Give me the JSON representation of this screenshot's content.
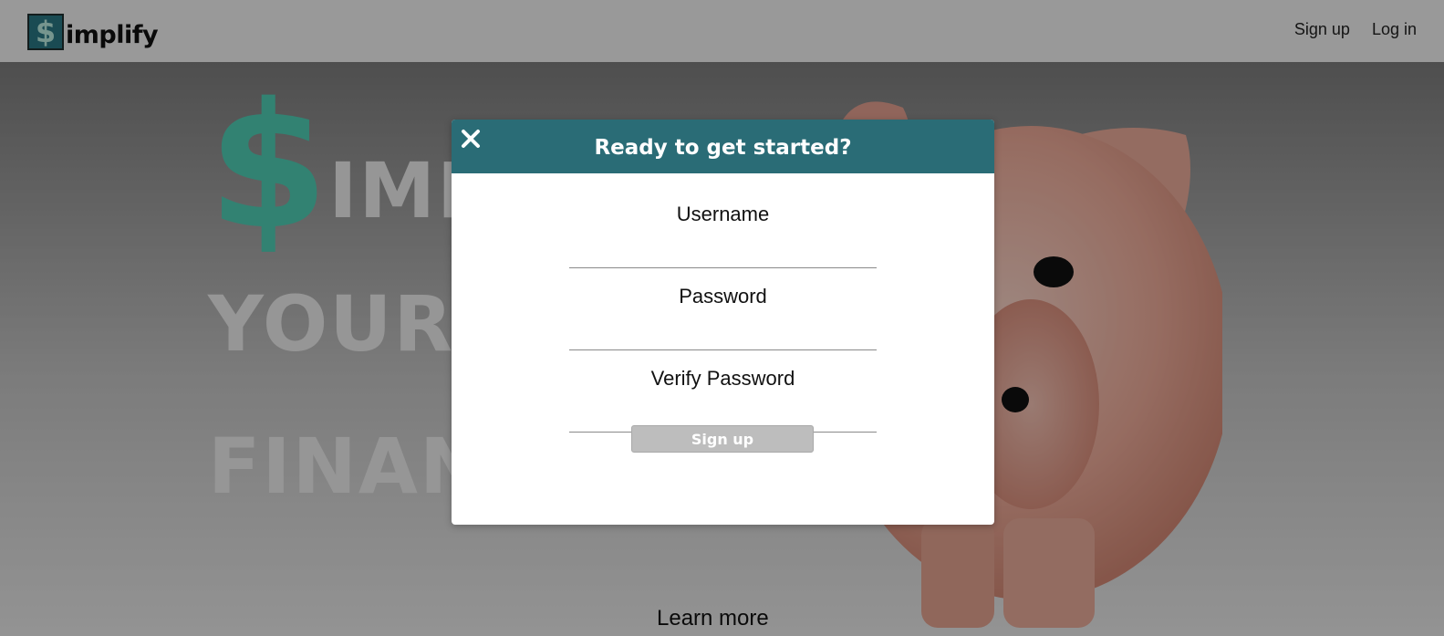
{
  "nav": {
    "logo_symbol": "$",
    "logo_text": "implify",
    "links": [
      {
        "label": "Sign up"
      },
      {
        "label": "Log in"
      }
    ]
  },
  "hero": {
    "dollar": "$",
    "word1": "IMPLIFY",
    "word2": "YOUR",
    "word3": "FINANCES",
    "learn_more": "Learn more"
  },
  "modal": {
    "title": "Ready to get started?",
    "close_icon": "close-icon",
    "fields": [
      {
        "label": "Username",
        "value": ""
      },
      {
        "label": "Password",
        "value": ""
      },
      {
        "label": "Verify Password",
        "value": ""
      }
    ],
    "submit_label": "Sign up"
  },
  "colors": {
    "brand_teal": "#2a6c76",
    "logo_dollar": "#52d2b9",
    "overlay": "rgba(0,0,0,0.38)",
    "button_disabled": "#bdbdbd"
  }
}
